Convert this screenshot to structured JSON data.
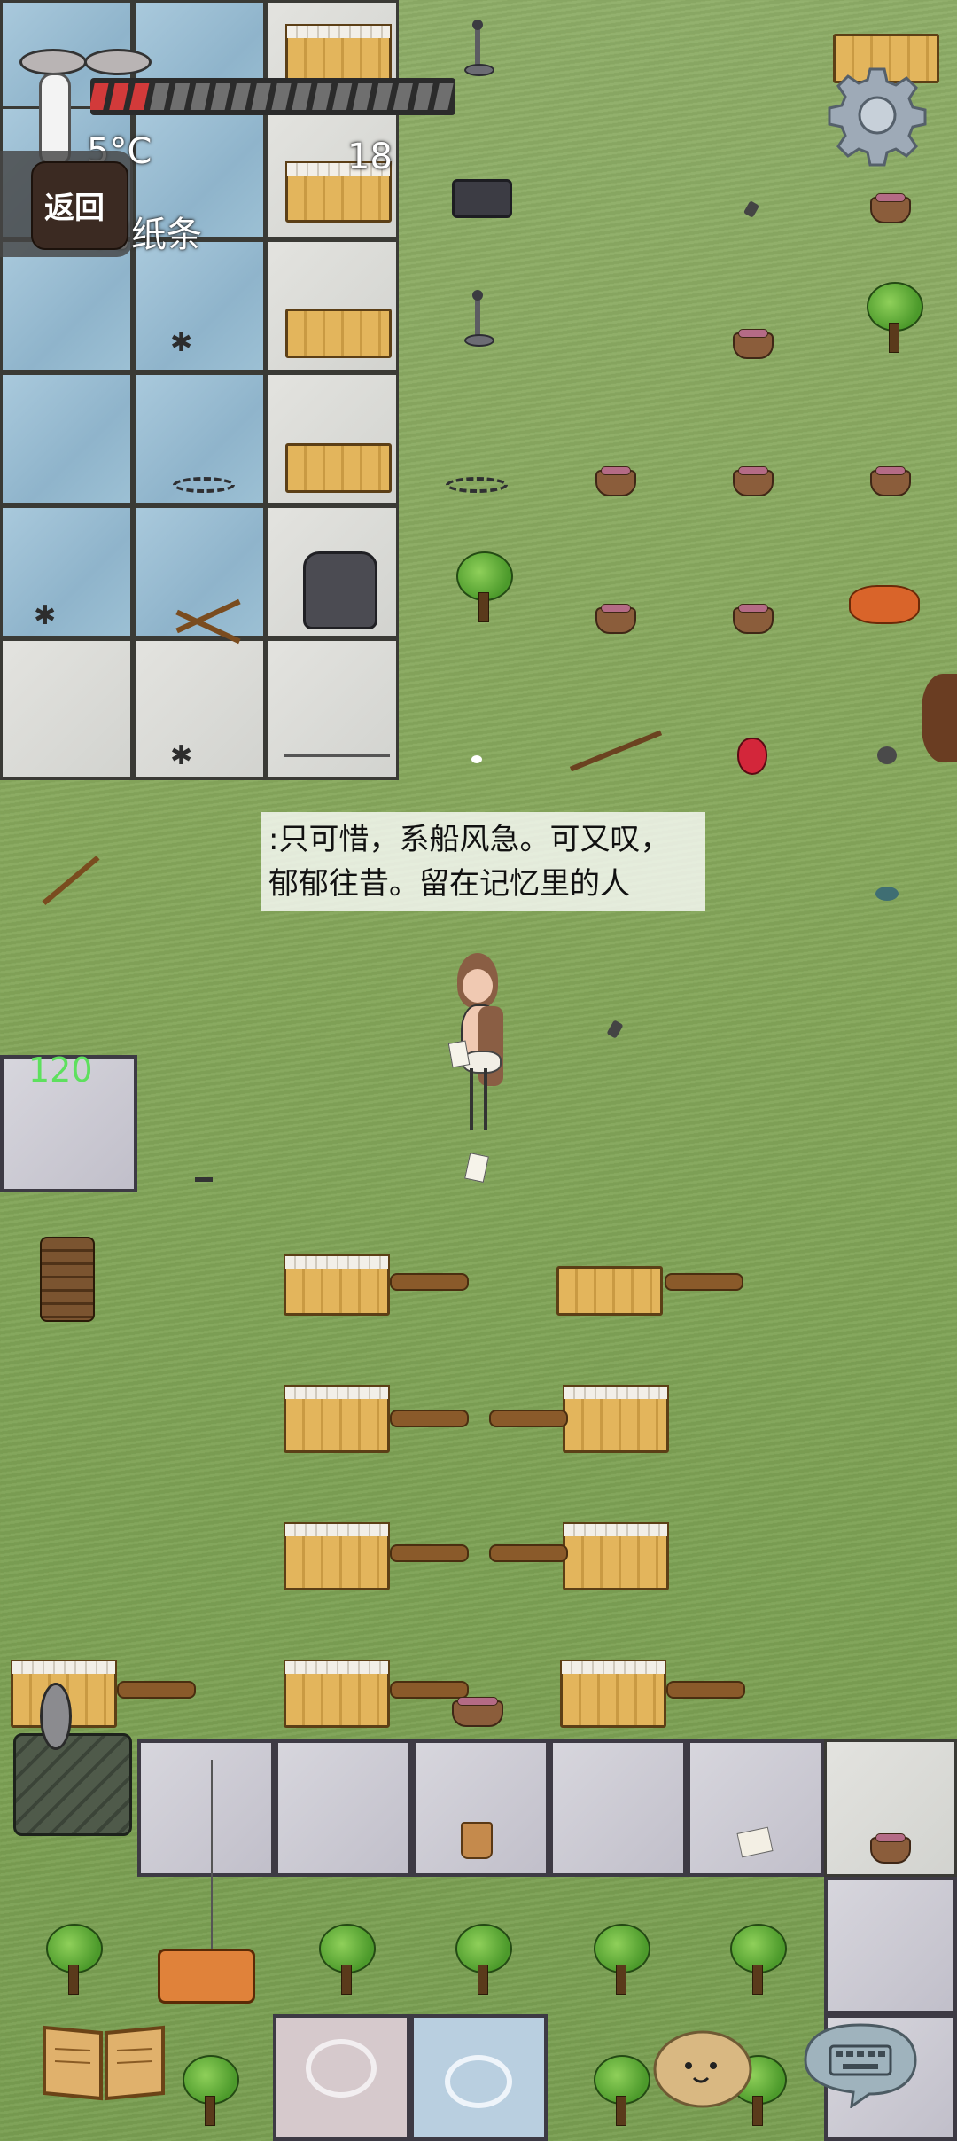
{
  "hud": {
    "back_label": "返回",
    "temperature": "5°C",
    "held_item": "的纸条",
    "food_count": "18",
    "hunger_pips_total": 18,
    "hunger_pips_red": 3,
    "age_counter": "120"
  },
  "speech": {
    "text": ":只可惜，系船风急。可又叹，郁郁往昔。留在记忆里的人"
  },
  "icons": {
    "settings": "gear-icon",
    "journal": "book-icon",
    "emote": "potato-face-icon",
    "keyboard": "keyboard-icon",
    "thermometer": "thermometer-icon"
  },
  "colors": {
    "grass": "#86a85c",
    "water_tile": "#9cc0d4",
    "stone_tile": "#c8c6cf",
    "hunger_red": "#d23a3a",
    "age_green": "#5ee05e"
  }
}
